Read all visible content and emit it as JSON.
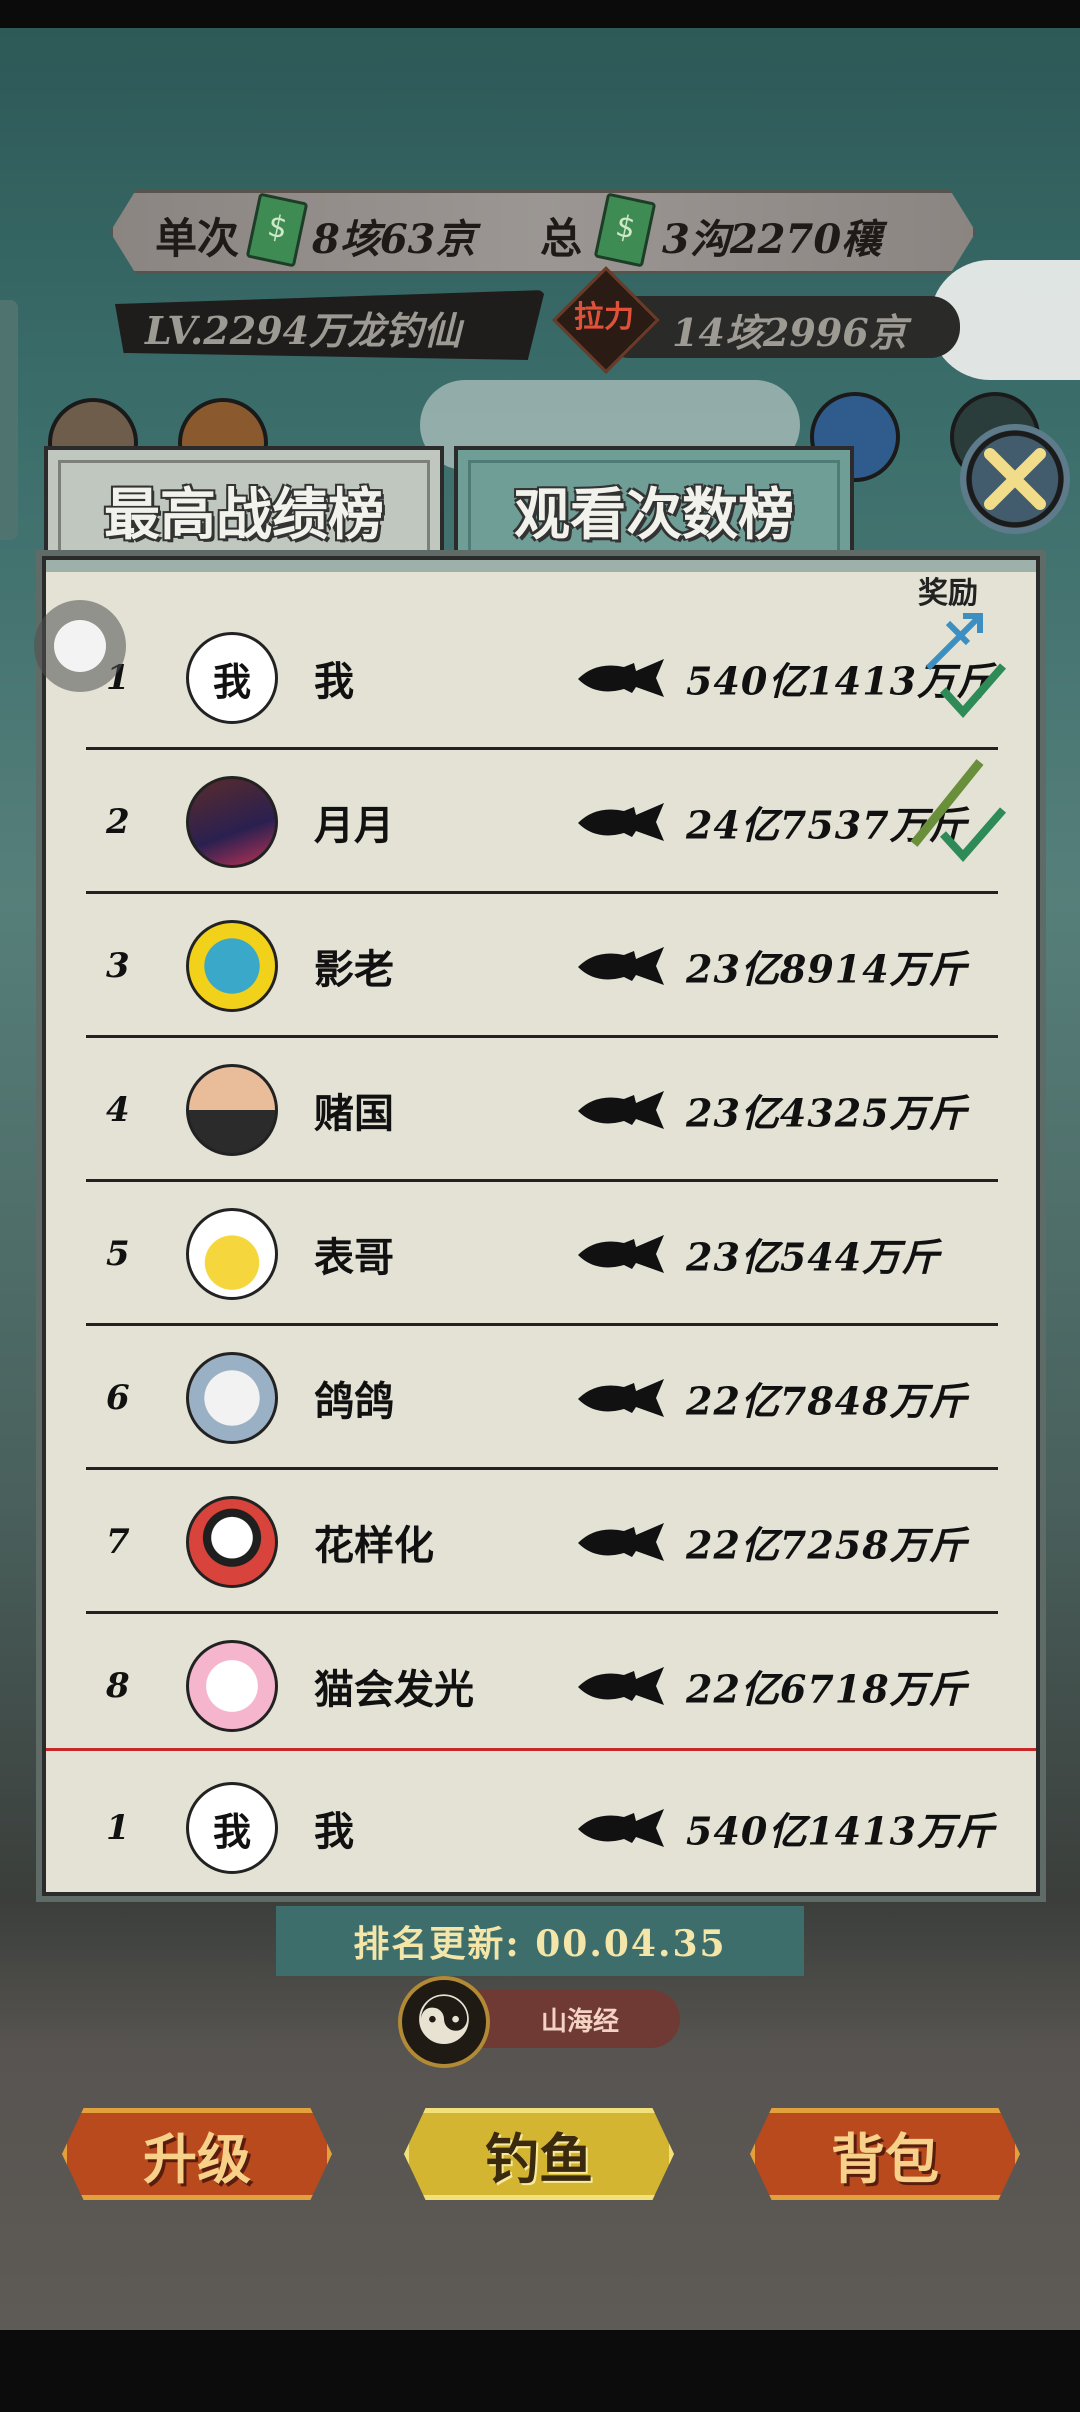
{
  "hud": {
    "single_label": "单次",
    "single_value": "8垓63京",
    "total_label": "总",
    "total_value": "3沟2270穰",
    "level_text": "LV.2294万龙钓仙",
    "pull_label": "拉力",
    "pull_value": "14垓2996京"
  },
  "tabs": [
    {
      "label": "最高战绩榜",
      "active": true
    },
    {
      "label": "观看次数榜",
      "active": false
    }
  ],
  "board": {
    "reward_label": "奖励",
    "rows": [
      {
        "rank": "1",
        "name": "我",
        "avatar_text": "我",
        "score": "540亿1413万斤",
        "claimed": true
      },
      {
        "rank": "2",
        "name": "月月",
        "avatar_text": "",
        "score": "24亿7537万斤",
        "claimed": true
      },
      {
        "rank": "3",
        "name": "影老",
        "avatar_text": "",
        "score": "23亿8914万斤"
      },
      {
        "rank": "4",
        "name": "赌国",
        "avatar_text": "",
        "score": "23亿4325万斤"
      },
      {
        "rank": "5",
        "name": "表哥",
        "avatar_text": "",
        "score": "23亿544万斤"
      },
      {
        "rank": "6",
        "name": "鸽鸽",
        "avatar_text": "",
        "score": "22亿7848万斤"
      },
      {
        "rank": "7",
        "name": "花样化",
        "avatar_text": "",
        "score": "22亿7258万斤"
      },
      {
        "rank": "8",
        "name": "猫会发光",
        "avatar_text": "",
        "score": "22亿6718万斤"
      }
    ],
    "self_row": {
      "rank": "1",
      "name": "我",
      "avatar_text": "我",
      "score": "540亿1413万斤"
    }
  },
  "update": {
    "text": "排名更新: 00.04.35"
  },
  "realm": {
    "label": "山海经"
  },
  "buttons": {
    "upgrade": "升级",
    "fishing": "钓鱼",
    "bag": "背包"
  },
  "colors": {
    "panel": "#e3e2d5",
    "accent_red": "#c62828",
    "tab_active": "#bfc7bf",
    "tab_inactive": "#6f9e97"
  }
}
